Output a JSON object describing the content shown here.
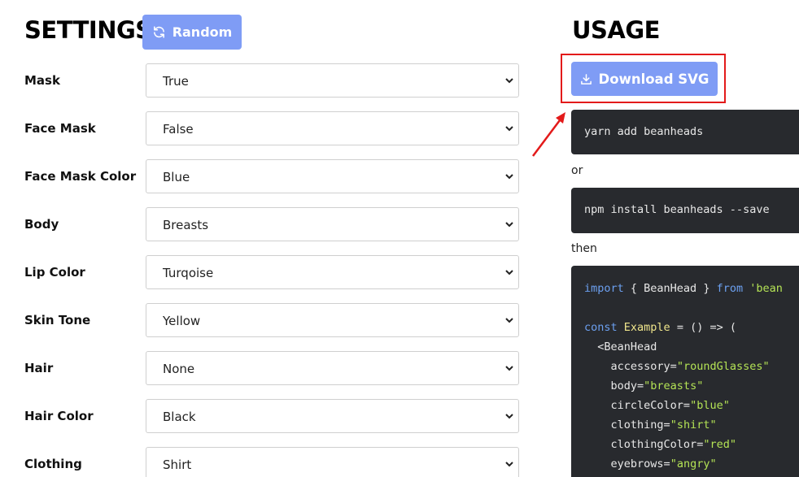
{
  "settings": {
    "title": "SETTINGS",
    "random_label": "Random",
    "rows": [
      {
        "label": "Mask",
        "value": "True"
      },
      {
        "label": "Face Mask",
        "value": "False"
      },
      {
        "label": "Face Mask Color",
        "value": "Blue"
      },
      {
        "label": "Body",
        "value": "Breasts"
      },
      {
        "label": "Lip Color",
        "value": "Turqoise"
      },
      {
        "label": "Skin Tone",
        "value": "Yellow"
      },
      {
        "label": "Hair",
        "value": "None"
      },
      {
        "label": "Hair Color",
        "value": "Black"
      },
      {
        "label": "Clothing",
        "value": "Shirt"
      }
    ]
  },
  "usage": {
    "title": "USAGE",
    "download_label": "Download SVG",
    "yarn_cmd": "yarn add beanheads",
    "or_text": "or",
    "npm_cmd": "npm install beanheads --save",
    "then_text": "then",
    "code": {
      "import_kw": "import",
      "import_mid": " { BeanHead } ",
      "from_kw": "from",
      "import_str": "'bean",
      "const_kw": "const",
      "example_name": "Example",
      "arrow_rest": " = () => (",
      "beanhead_open": "  <BeanHead",
      "props": [
        {
          "name": "accessory",
          "value": "\"roundGlasses\""
        },
        {
          "name": "body",
          "value": "\"breasts\""
        },
        {
          "name": "circleColor",
          "value": "\"blue\""
        },
        {
          "name": "clothing",
          "value": "\"shirt\""
        },
        {
          "name": "clothingColor",
          "value": "\"red\""
        },
        {
          "name": "eyebrows",
          "value": "\"angry\""
        }
      ]
    }
  },
  "colors": {
    "accent": "#7f9cf5",
    "highlight": "#e31a1a",
    "code_bg": "#282a2e"
  }
}
